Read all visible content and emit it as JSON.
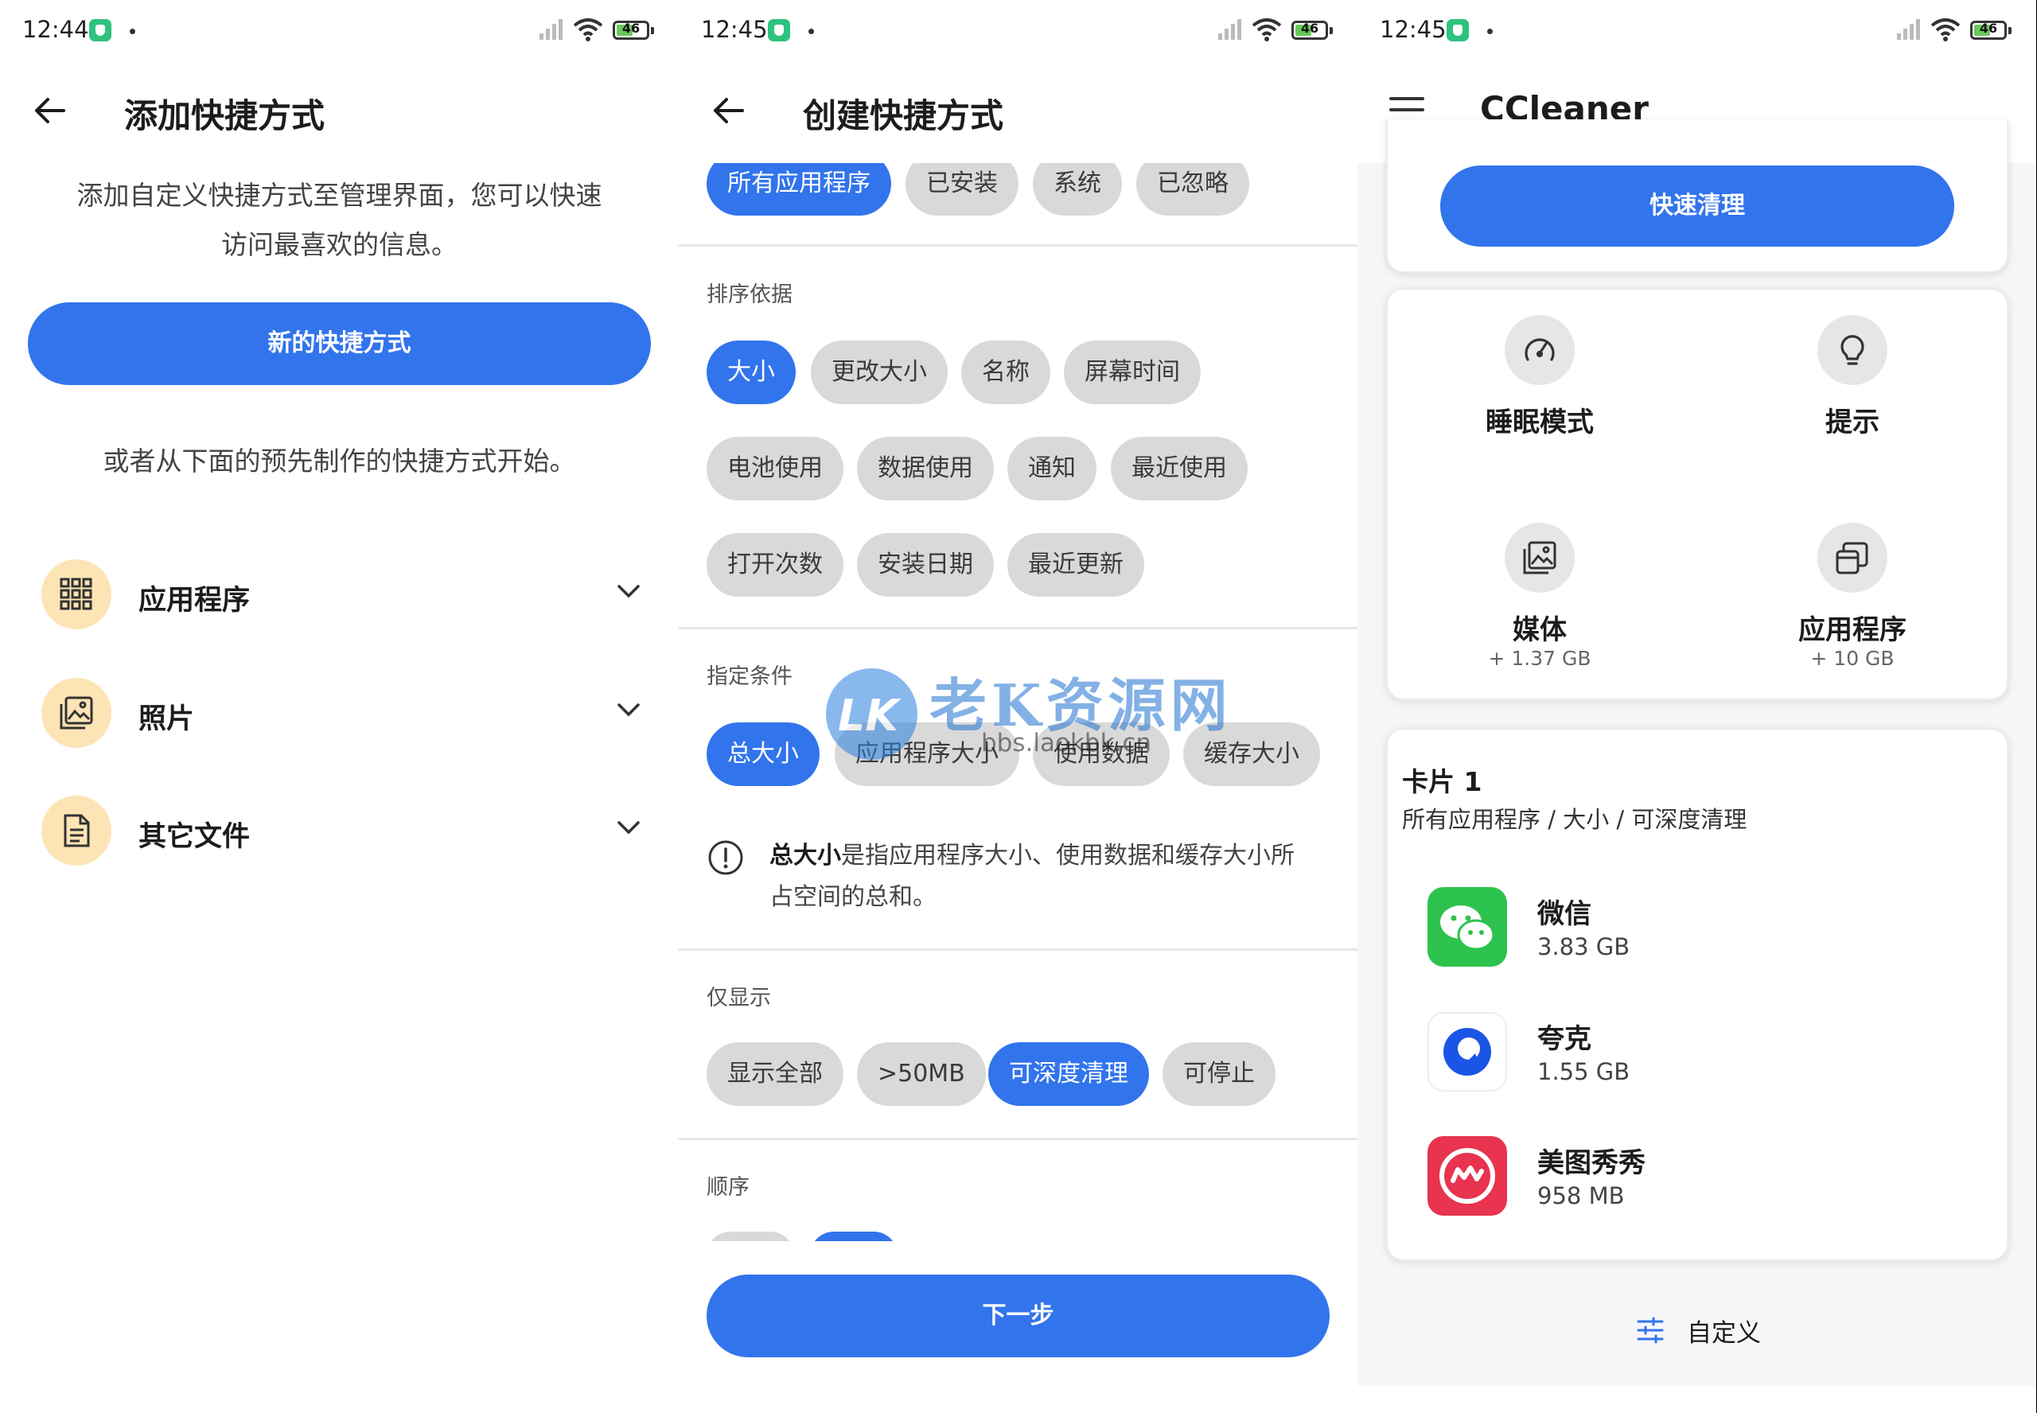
{
  "colors": {
    "accent": "#3274ec",
    "chip": "#d9d9d9",
    "category_bg": "#fde4b4"
  },
  "panel1": {
    "status_time": "12:44",
    "battery": "46",
    "title": "添加快捷方式",
    "desc_line1": "添加自定义快捷方式至管理界面，您可以快速",
    "desc_line2": "访问最喜欢的信息。",
    "new_button": "新的快捷方式",
    "or_text": "或者从下面的预先制作的快捷方式开始。",
    "categories": [
      {
        "label": "应用程序",
        "icon": "grid-icon"
      },
      {
        "label": "照片",
        "icon": "photo-icon"
      },
      {
        "label": "其它文件",
        "icon": "document-icon"
      }
    ]
  },
  "panel2": {
    "status_time": "12:45",
    "battery": "46",
    "title": "创建快捷方式",
    "filter_chips": [
      "所有应用程序",
      "已安装",
      "系统",
      "已忽略"
    ],
    "sort_label": "排序依据",
    "sort_chips": [
      "大小",
      "更改大小",
      "名称",
      "屏幕时间",
      "电池使用",
      "数据使用",
      "通知",
      "最近使用",
      "打开次数",
      "安装日期",
      "最近更新"
    ],
    "condition_label": "指定条件",
    "condition_chips": [
      "总大小",
      "应用程序大小",
      "使用数据",
      "缓存大小"
    ],
    "info_bold": "总大小",
    "info_line1": "是指应用程序大小、使用数据和缓存大小所",
    "info_line2": "占空间的总和。",
    "show_label": "仅显示",
    "show_chips": [
      "显示全部",
      ">50MB",
      "可深度清理",
      "可停止"
    ],
    "order_label": "顺序",
    "next_button": "下一步",
    "watermark_main": "老K资源网",
    "watermark_sub": "bbs.laokbk.cn",
    "watermark_logo": "LK"
  },
  "panel3": {
    "status_time": "12:45",
    "battery": "46",
    "title": "CCleaner",
    "quick_clean": "快速清理",
    "tiles": [
      {
        "label": "睡眠模式",
        "sub": "",
        "icon": "gauge-icon"
      },
      {
        "label": "提示",
        "sub": "",
        "icon": "bulb-icon"
      },
      {
        "label": "媒体",
        "sub": "+ 1.37 GB",
        "icon": "media-icon"
      },
      {
        "label": "应用程序",
        "sub": "+ 10 GB",
        "icon": "apps-icon"
      }
    ],
    "card_title": "卡片 1",
    "card_sub": "所有应用程序 / 大小 / 可深度清理",
    "apps": [
      {
        "name": "微信",
        "size": "3.83 GB",
        "color": "#2dc24e"
      },
      {
        "name": "夸克",
        "size": "1.55 GB",
        "color": "#1a55e6"
      },
      {
        "name": "美图秀秀",
        "size": "958 MB",
        "color": "#e8344e"
      }
    ],
    "customize": "自定义"
  }
}
